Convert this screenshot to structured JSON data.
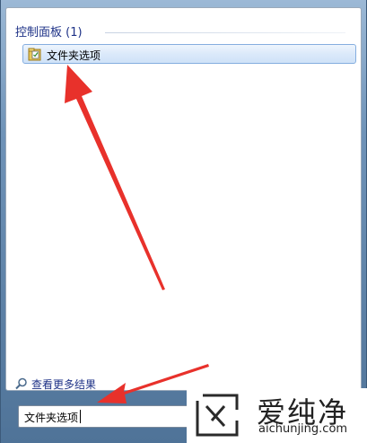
{
  "results_panel": {
    "group_header": "控制面板 (1)",
    "items": [
      {
        "label": "文件夹选项",
        "icon": "folder-options-icon"
      }
    ]
  },
  "see_more": {
    "label": "查看更多结果",
    "icon": "magnifier-icon"
  },
  "search": {
    "value": "文件夹选项"
  },
  "watermark": {
    "brand": "爱纯净",
    "domain": "aichunjing.com"
  },
  "colors": {
    "highlight_border": "#85aedf",
    "header_text": "#1e3287",
    "arrow_red": "#e8312b"
  }
}
